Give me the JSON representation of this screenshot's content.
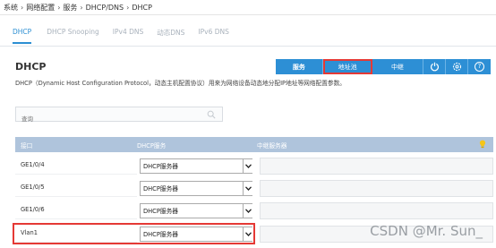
{
  "breadcrumb": [
    "系统",
    "网络配置",
    "服务",
    "DHCP/DNS",
    "DHCP"
  ],
  "tabs": [
    {
      "label": "DHCP",
      "active": true
    },
    {
      "label": "DHCP Snooping",
      "active": false
    },
    {
      "label": "IPv4 DNS",
      "active": false
    },
    {
      "label": "动态DNS",
      "active": false
    },
    {
      "label": "IPv6 DNS",
      "active": false
    }
  ],
  "page": {
    "title": "DHCP",
    "description": "DHCP（Dynamic Host Configuration Protocol，动态主机配置协议）用来为网络设备动态地分配IP地址等网络配置参数。"
  },
  "toolbar": {
    "service_label": "服务",
    "pool_label": "地址池",
    "relay_label": "中继",
    "icons": [
      "power-icon",
      "gear-icon",
      "help-icon"
    ]
  },
  "search": {
    "placeholder": "查询",
    "value": ""
  },
  "table": {
    "columns": [
      "接口",
      "DHCP服务",
      "中继服务器"
    ],
    "rows": [
      {
        "interface": "GE1/0/4",
        "service": "DHCP服务器",
        "relay": ""
      },
      {
        "interface": "GE1/0/5",
        "service": "DHCP服务器",
        "relay": ""
      },
      {
        "interface": "GE1/0/6",
        "service": "DHCP服务器",
        "relay": ""
      },
      {
        "interface": "Vlan1",
        "service": "DHCP服务器",
        "relay": ""
      }
    ]
  },
  "watermark": "CSDN @Mr. Sun_",
  "colors": {
    "accent": "#2d8fd5",
    "highlight": "#e53935",
    "table_header": "#afc4dc"
  }
}
